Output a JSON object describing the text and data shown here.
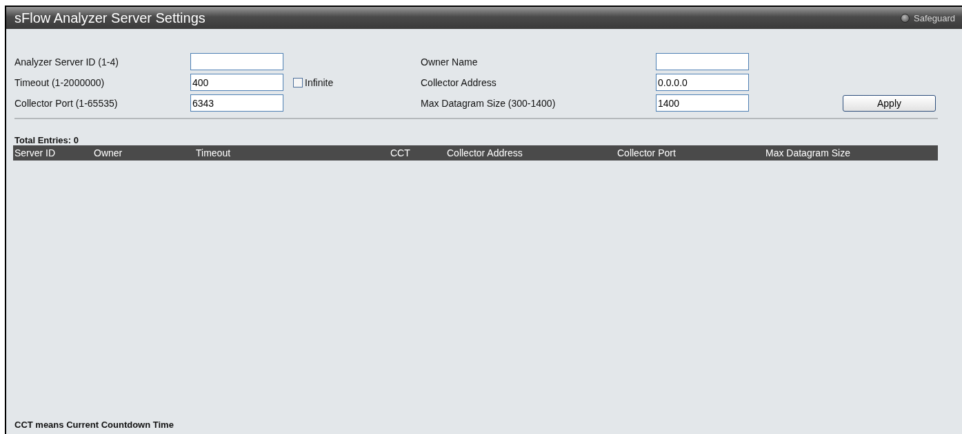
{
  "window": {
    "title": "sFlow Analyzer Server Settings",
    "safeguard": "Safeguard"
  },
  "form": {
    "rows": [
      {
        "label": "Analyzer Server ID (1-4)",
        "value": "",
        "right_label": "Owner Name",
        "right_value": ""
      },
      {
        "label": "Timeout (1-2000000)",
        "value": "400",
        "checkbox": {
          "label": "Infinite",
          "checked": false
        },
        "right_label": "Collector Address",
        "right_value": "0.0.0.0"
      },
      {
        "label": "Collector Port (1-65535)",
        "value": "6343",
        "right_label": "Max Datagram Size (300-1400)",
        "right_value": "1400",
        "button": "Apply"
      }
    ]
  },
  "table": {
    "total": "Total Entries: 0",
    "columns": [
      "Server ID",
      "Owner",
      "Timeout",
      "CCT",
      "Collector Address",
      "Collector Port",
      "Max Datagram Size"
    ]
  },
  "footnote": "CCT means Current Countdown Time"
}
